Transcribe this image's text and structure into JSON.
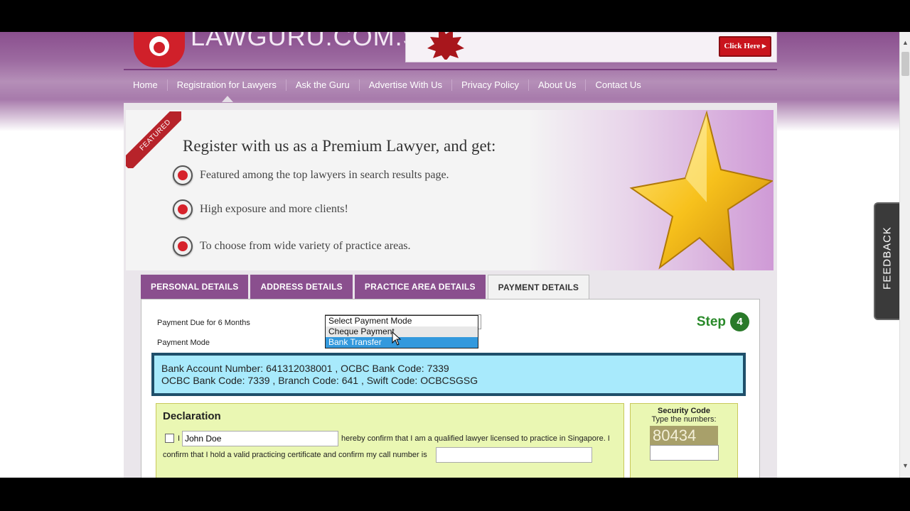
{
  "header": {
    "logo_text": "LAWGURU.COM.SG",
    "banner_button": "Click Here"
  },
  "nav": {
    "items": [
      "Home",
      "Registration for Lawyers",
      "Ask the Guru",
      "Advertise With Us",
      "Privacy Policy",
      "About Us",
      "Contact Us"
    ]
  },
  "hero": {
    "ribbon": "FEATURED",
    "title": "Register with us as a Premium Lawyer, and get:",
    "points": [
      "Featured among the top lawyers in search results page.",
      "High exposure and more clients!",
      "To choose from wide variety of practice areas."
    ]
  },
  "tabs": [
    "PERSONAL DETAILS",
    "ADDRESS DETAILS",
    "PRACTICE AREA DETAILS",
    "PAYMENT DETAILS"
  ],
  "form": {
    "payment_due_label": "Payment Due for 6 Months",
    "payment_mode_label": "Payment Mode",
    "payment_options": [
      "Select Payment Mode",
      "Cheque Payment",
      "Bank Transfer"
    ],
    "step_label": "Step",
    "step_number": "4",
    "bank_line1": "Bank Account Number: 641312038001 , OCBC Bank Code: 7339",
    "bank_line2": "OCBC Bank Code: 7339 , Branch Code: 641 , Swift Code: OCBCSGSG"
  },
  "declaration": {
    "title": "Declaration",
    "prefix": "I",
    "name_value": "John Doe",
    "text1": "hereby confirm that I am a qualified lawyer licensed to practice in Singapore. I",
    "text2": "confirm that I hold a valid practicing certificate and confirm my call number is"
  },
  "security": {
    "title": "Security Code",
    "subtitle": "Type the numbers:",
    "captcha": "80434"
  },
  "feedback": "FEEDBACK",
  "colors": {
    "brand_purple": "#8a4f8e",
    "bank_box": "#a8eafc",
    "declaration_bg": "#eaf7b3",
    "step_green": "#2a8a2a",
    "accent_red": "#d0202a"
  }
}
